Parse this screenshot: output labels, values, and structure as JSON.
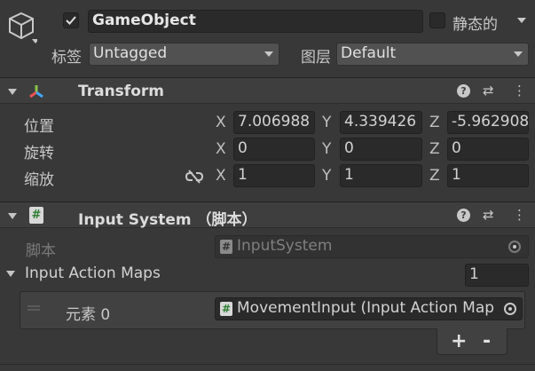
{
  "object": {
    "checked": true,
    "name": "GameObject",
    "static_label": "静态的",
    "tag_label": "标签",
    "tag_value": "Untagged",
    "layer_label": "图层",
    "layer_value": "Default"
  },
  "transform": {
    "title": "Transform",
    "position_label": "位置",
    "rotation_label": "旋转",
    "scale_label": "缩放",
    "axis_x": "X",
    "axis_y": "Y",
    "axis_z": "Z",
    "position": {
      "x": "7.006988",
      "y": "4.339426",
      "z": "-5.962908"
    },
    "rotation": {
      "x": "0",
      "y": "0",
      "z": "0"
    },
    "scale": {
      "x": "1",
      "y": "1",
      "z": "1"
    }
  },
  "input_system": {
    "title": "Input System （脚本）",
    "script_label": "脚本",
    "script_value": "InputSystem",
    "maps_label": "Input Action Maps",
    "maps_count": "1",
    "element_label": "元素 0",
    "element_value": "MovementInput (Input Action Map",
    "add_label": "+",
    "remove_label": "-"
  },
  "icons": {
    "help": "?",
    "presets": "⇄",
    "more": "⋮",
    "script_glyph": "#"
  }
}
